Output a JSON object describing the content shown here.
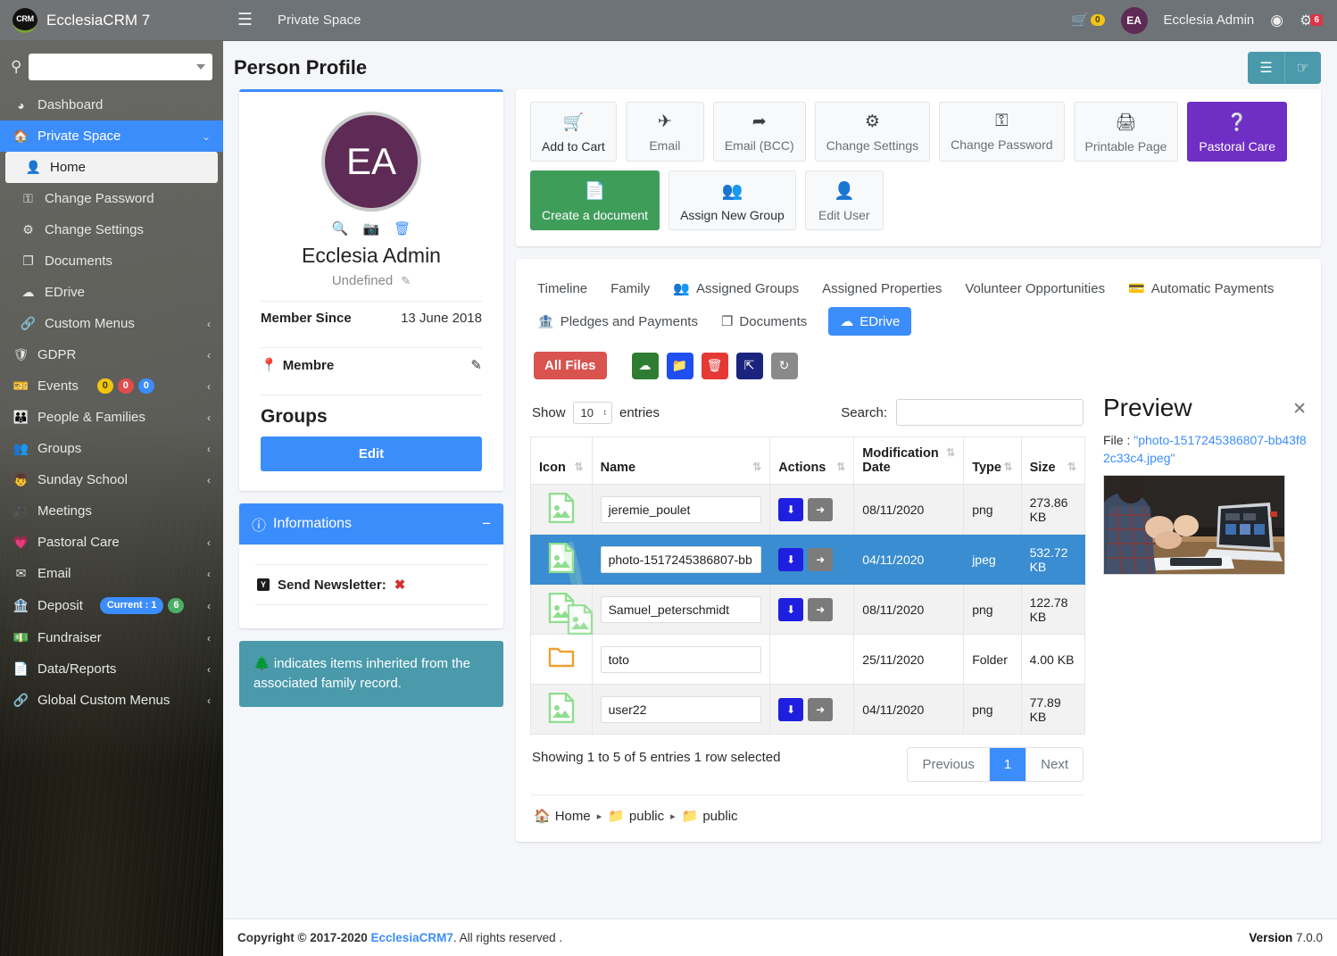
{
  "brand": {
    "logo_text": "CRM",
    "title": "EcclesiaCRM 7"
  },
  "sidebar": {
    "search_placeholder": "",
    "search_value": "",
    "items": [
      {
        "label": "Dashboard",
        "icon": "dashboard-icon",
        "arrow": ""
      },
      {
        "label": "Private Space",
        "icon": "home-icon",
        "arrow": "chevron-down-icon",
        "active": true
      },
      {
        "label": "Change Password",
        "icon": "key-icon",
        "arrow": ""
      },
      {
        "label": "Change Settings",
        "icon": "gear-icon",
        "arrow": ""
      },
      {
        "label": "Documents",
        "icon": "documents-icon",
        "arrow": ""
      },
      {
        "label": "EDrive",
        "icon": "cloud-icon",
        "arrow": ""
      },
      {
        "label": "Custom Menus",
        "icon": "link-icon",
        "arrow": "chevron-left-icon"
      },
      {
        "label": "GDPR",
        "icon": "shield-icon",
        "arrow": "chevron-left-icon"
      },
      {
        "label": "Events",
        "icon": "tickets-icon",
        "arrow": "chevron-left-icon",
        "badges": [
          "0",
          "0",
          "0"
        ]
      },
      {
        "label": "People & Families",
        "icon": "people-icon",
        "arrow": "chevron-left-icon"
      },
      {
        "label": "Groups",
        "icon": "groups-icon",
        "arrow": "chevron-left-icon"
      },
      {
        "label": "Sunday School",
        "icon": "child-icon",
        "arrow": "chevron-left-icon"
      },
      {
        "label": "Meetings",
        "icon": "video-icon",
        "arrow": ""
      },
      {
        "label": "Pastoral Care",
        "icon": "heart-pulse-icon",
        "arrow": "chevron-left-icon"
      },
      {
        "label": "Email",
        "icon": "envelope-icon",
        "arrow": "chevron-left-icon"
      },
      {
        "label": "Deposit",
        "icon": "bank-icon",
        "arrow": "chevron-left-icon",
        "pill": "Current : 1",
        "badge_green": "6"
      },
      {
        "label": "Fundraiser",
        "icon": "money-icon",
        "arrow": "chevron-left-icon"
      },
      {
        "label": "Data/Reports",
        "icon": "file-pdf-icon",
        "arrow": "chevron-left-icon"
      },
      {
        "label": "Global Custom Menus",
        "icon": "link-icon",
        "arrow": "chevron-left-icon"
      }
    ],
    "submenu": {
      "home_label": "Home"
    }
  },
  "topnav": {
    "menu_icon": "hamburger-icon",
    "space_label": "Private Space",
    "cart_count": "0",
    "avatar_initials": "EA",
    "user_name": "Ecclesia Admin",
    "help_icon": "lifebuoy-icon",
    "gear_count": "6"
  },
  "page": {
    "title": "Person Profile",
    "head_buttons": [
      {
        "name": "list-view-button",
        "icon": "list-icon"
      },
      {
        "name": "hand-pointer-button",
        "icon": "hand-pointer-icon"
      }
    ]
  },
  "profile": {
    "avatar_initials": "EA",
    "tools": [
      {
        "name": "zoom-photo-icon",
        "glyph": "search"
      },
      {
        "name": "camera-icon",
        "glyph": "camera"
      },
      {
        "name": "delete-photo-icon",
        "glyph": "trash"
      }
    ],
    "name": "Ecclesia Admin",
    "subtitle": "Undefined",
    "member_since_label": "Member Since",
    "member_since_value": "13 June 2018",
    "classification": "Membre",
    "groups_heading": "Groups",
    "edit_button": "Edit"
  },
  "informations": {
    "title": "Informations",
    "collapse_icon": "minus-icon",
    "items": [
      {
        "badge": "Y",
        "label": "Send Newsletter:",
        "value": "✖"
      }
    ]
  },
  "inherit_note": "indicates items inherited from the associated family record.",
  "actions": {
    "row1": [
      {
        "label": "Add to Cart",
        "icon": "cart-plus-icon",
        "style": "dark"
      },
      {
        "label": "Email",
        "icon": "paper-plane-outline-icon",
        "style": ""
      },
      {
        "label": "Email (BCC)",
        "icon": "paper-plane-icon",
        "style": ""
      },
      {
        "label": "Change Settings",
        "icon": "gear-icon",
        "style": ""
      },
      {
        "label": "Change Password",
        "icon": "key-icon",
        "style": ""
      },
      {
        "label": "Printable Page",
        "icon": "printer-icon",
        "style": ""
      },
      {
        "label": "Pastoral Care",
        "icon": "question-circle-icon",
        "style": "purple"
      }
    ],
    "row2": [
      {
        "label": "Create a document",
        "icon": "file-icon",
        "style": "green"
      },
      {
        "label": "Assign New Group",
        "icon": "users-icon",
        "style": "dark"
      },
      {
        "label": "Edit User",
        "icon": "user-tie-icon",
        "style": ""
      }
    ]
  },
  "tabs": [
    {
      "label": "Timeline",
      "icon": ""
    },
    {
      "label": "Family",
      "icon": ""
    },
    {
      "label": "Assigned Groups",
      "icon": "users-icon"
    },
    {
      "label": "Assigned Properties",
      "icon": ""
    },
    {
      "label": "Volunteer Opportunities",
      "icon": ""
    },
    {
      "label": "Automatic Payments",
      "icon": "card-icon"
    },
    {
      "label": "Pledges and Payments",
      "icon": "bank-icon"
    },
    {
      "label": "Documents",
      "icon": "documents-icon"
    },
    {
      "label": "EDrive",
      "icon": "cloud-icon",
      "active": true
    }
  ],
  "edrive": {
    "toolbar": {
      "all_files_label": "All Files",
      "buttons": [
        {
          "name": "upload-button",
          "icon": "cloud-upload-icon",
          "color": "green"
        },
        {
          "name": "new-folder-button",
          "icon": "folder-icon",
          "color": "blue"
        },
        {
          "name": "delete-button",
          "icon": "trash-icon",
          "color": "red"
        },
        {
          "name": "move-up-button",
          "icon": "arrow-up-icon",
          "color": "navy"
        },
        {
          "name": "refresh-button",
          "icon": "refresh-icon",
          "color": "grey"
        }
      ]
    },
    "show_label": "Show",
    "entries_label": "entries",
    "page_size": "10",
    "search_label": "Search:",
    "search_value": "",
    "columns": [
      "Icon",
      "Name",
      "Actions",
      "Modification Date",
      "Type",
      "Size"
    ],
    "rows": [
      {
        "icon": "image-file-icon",
        "name": "jeremie_poulet",
        "has_actions": true,
        "date": "08/11/2020",
        "type": "png",
        "size": "273.86 KB",
        "selected": false
      },
      {
        "icon": "image-file-icon",
        "name": "photo-1517245386807-bb",
        "has_actions": true,
        "date": "04/11/2020",
        "type": "jpeg",
        "size": "532.72 KB",
        "selected": true
      },
      {
        "icon": "image-file-icon",
        "name": "Samuel_peterschmidt",
        "has_actions": true,
        "date": "08/11/2020",
        "type": "png",
        "size": "122.78 KB",
        "selected": false
      },
      {
        "icon": "folder-icon",
        "name": "toto",
        "has_actions": false,
        "date": "25/11/2020",
        "type": "Folder",
        "size": "4.00 KB",
        "selected": false
      },
      {
        "icon": "image-file-icon",
        "name": "user22",
        "has_actions": true,
        "date": "04/11/2020",
        "type": "png",
        "size": "77.89 KB",
        "selected": false
      }
    ],
    "row_action_download": "download-icon",
    "row_action_share": "share-icon",
    "footer_info": "Showing 1 to 5 of 5 entries   1 row selected",
    "pager": {
      "previous": "Previous",
      "current": "1",
      "next": "Next"
    },
    "breadcrumb": [
      {
        "label": "Home",
        "icon": "home-icon"
      },
      {
        "label": "public",
        "icon": "folder-icon"
      },
      {
        "label": "public",
        "icon": "folder-icon"
      }
    ]
  },
  "preview": {
    "title": "Preview",
    "close_icon": "close-icon",
    "file_label": "File :",
    "file_name": "\"photo-1517245386807-bb43f82c33c4.jpeg\""
  },
  "footer": {
    "copyright_pre": "Copyright © 2017-2020",
    "brand": "EcclesiaCRM7",
    "copyright_post": ". All rights reserved .",
    "version_label": "Version",
    "version_value": "7.0.0"
  },
  "colors": {
    "primary": "#3c8dfc",
    "purple": "#6f2fc4",
    "green": "#3f9d5a",
    "teal": "#4a9aab",
    "danger": "#d9534f",
    "avatar": "#5d2b55"
  }
}
